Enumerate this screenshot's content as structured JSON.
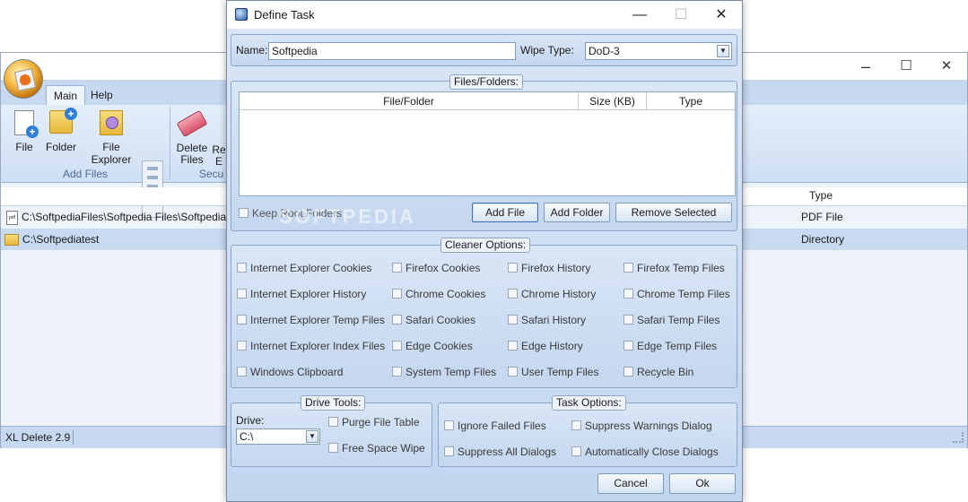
{
  "main_window": {
    "tabs": [
      "Main",
      "Help"
    ],
    "ribbon": {
      "buttons": {
        "file": "File",
        "folder": "Folder",
        "file_explorer": "File Explorer",
        "delete_line1": "Delete",
        "delete_line2": "Files",
        "partial_line1": "Re",
        "partial_line2": "E"
      },
      "group_add_files": "Add Files",
      "group_secure_partial": "Secu"
    },
    "list": {
      "column_type": "Type",
      "rows": [
        {
          "path": "C:\\SoftpediaFiles\\Softpedia Files\\Softpedia ima",
          "type": "PDF File"
        },
        {
          "path": "C:\\Softpediatest",
          "type": "Directory"
        }
      ]
    },
    "status": "XL Delete 2.9",
    "controls": {
      "minimize": "–",
      "maximize": "☐",
      "close": "✕"
    }
  },
  "dialog": {
    "title": "Define Task",
    "controls": {
      "minimize": "—",
      "maximize": "☐",
      "close": "✕"
    },
    "name_label": "Name:",
    "name_value": "Softpedia",
    "wipe_label": "Wipe Type:",
    "wipe_value": "DoD-3",
    "files_folders": {
      "title": "Files/Folders:",
      "columns": [
        "File/Folder",
        "Size (KB)",
        "Type"
      ],
      "keep_root": "Keep Root Folders",
      "add_file": "Add File",
      "add_folder": "Add Folder",
      "remove_selected": "Remove Selected"
    },
    "cleaner": {
      "title": "Cleaner Options:",
      "columns": [
        [
          "Internet Explorer Cookies",
          "Internet Explorer History",
          "Internet Explorer Temp Files",
          "Internet Explorer Index Files",
          "Windows Clipboard"
        ],
        [
          "Firefox Cookies",
          "Chrome Cookies",
          "Safari Cookies",
          "Edge Cookies",
          "System Temp Files"
        ],
        [
          "Firefox History",
          "Chrome History",
          "Safari History",
          "Edge History",
          "User Temp Files"
        ],
        [
          "Firefox Temp Files",
          "Chrome Temp Files",
          "Safari Temp Files",
          "Edge Temp Files",
          "Recycle Bin"
        ]
      ]
    },
    "drive_tools": {
      "title": "Drive Tools:",
      "drive_label": "Drive:",
      "drive_value": "C:\\",
      "purge": "Purge File Table",
      "free_space": "Free Space Wipe"
    },
    "task_options": {
      "title": "Task Options:",
      "ignore_failed": "Ignore Failed Files",
      "suppress_warnings": "Suppress Warnings Dialog",
      "suppress_all": "Suppress All Dialogs",
      "auto_close": "Automatically Close Dialogs"
    },
    "cancel": "Cancel",
    "ok": "Ok"
  },
  "watermark": "SOFTPEDIA"
}
